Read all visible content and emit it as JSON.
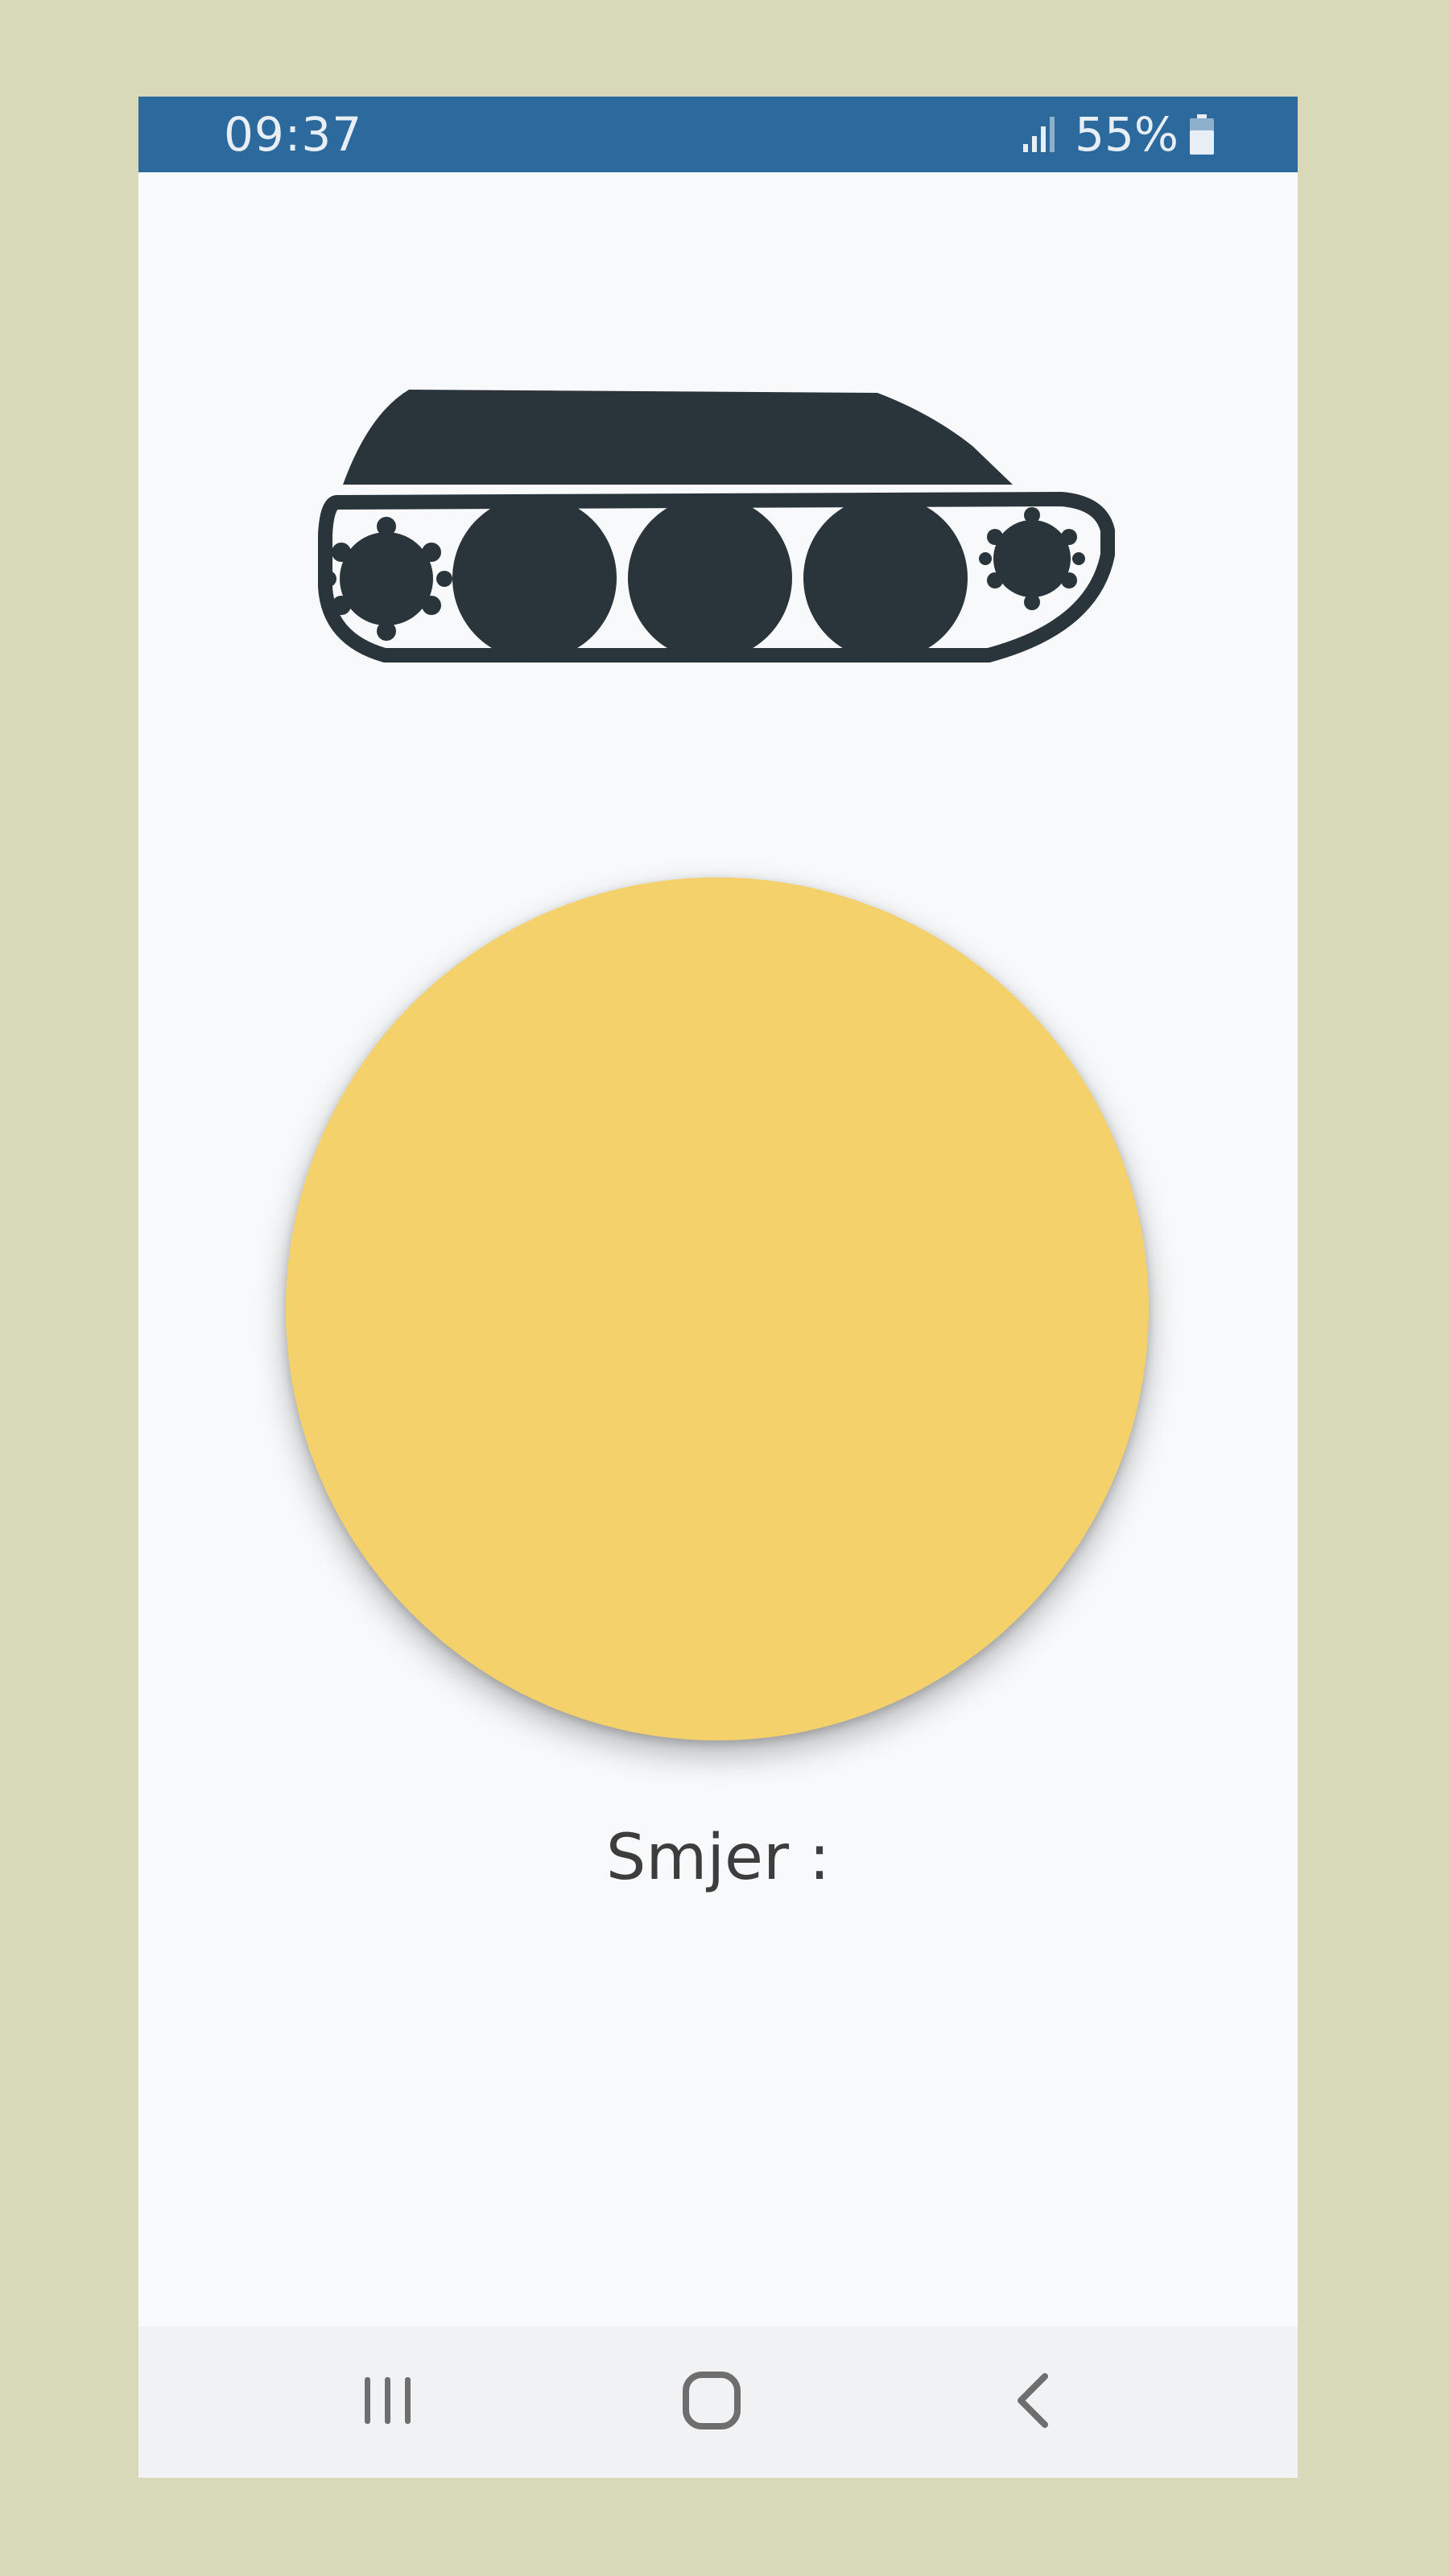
{
  "status_bar": {
    "time": "09:37",
    "battery_percent": "55%",
    "signal_icon": "signal-icon",
    "battery_icon": "battery-icon",
    "battery_level": 0.55,
    "background_color": "#2c6a9e"
  },
  "main": {
    "logo_icon": "tank-icon",
    "joystick_color": "#f4d16a",
    "direction_label": "Smjer :"
  },
  "nav_bar": {
    "recents_icon": "recents-icon",
    "home_icon": "home-icon",
    "back_icon": "back-icon"
  }
}
